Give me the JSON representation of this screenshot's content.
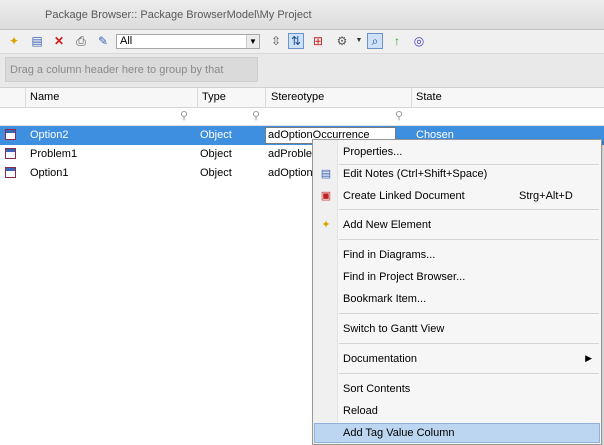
{
  "window": {
    "title": "Package Browser:: Package BrowserModel\\My Project"
  },
  "toolbar": {
    "filter_value": "All",
    "buttons": [
      {
        "name": "new-element-icon",
        "glyph": "✦"
      },
      {
        "name": "notes-icon",
        "glyph": "▤"
      },
      {
        "name": "delete-icon",
        "glyph": "✕"
      },
      {
        "name": "print-icon",
        "glyph": "⎙"
      },
      {
        "name": "edit-icon",
        "glyph": "✎"
      }
    ]
  },
  "group_panel": {
    "hint": "Drag a column header here to group by that column."
  },
  "grid": {
    "columns": [
      "Name",
      "Type",
      "Stereotype",
      "State"
    ],
    "rows": [
      {
        "name": "Option2",
        "type": "Object",
        "stereotype": "adOptionOccurrence",
        "state": "Chosen",
        "selected": true
      },
      {
        "name": "Problem1",
        "type": "Object",
        "stereotype": "adProble",
        "state": "",
        "selected": false
      },
      {
        "name": "Option1",
        "type": "Object",
        "stereotype": "adOption",
        "state": "",
        "selected": false
      }
    ]
  },
  "context_menu": {
    "items": [
      {
        "label": "Properties...",
        "shortcut": "",
        "icon": ""
      },
      {
        "label": "Edit Notes (Ctrl+Shift+Space)",
        "shortcut": "",
        "icon": "notes-icon"
      },
      {
        "label": "Create Linked Document",
        "shortcut": "Strg+Alt+D",
        "icon": "linked-document-icon"
      },
      {
        "label": "Add New Element",
        "shortcut": "",
        "icon": "new-element-icon"
      },
      {
        "label": "Find in Diagrams...",
        "shortcut": "",
        "icon": ""
      },
      {
        "label": "Find in Project Browser...",
        "shortcut": "",
        "icon": ""
      },
      {
        "label": "Bookmark Item...",
        "shortcut": "",
        "icon": ""
      },
      {
        "label": "Switch to Gantt View",
        "shortcut": "",
        "icon": ""
      },
      {
        "label": "Documentation",
        "shortcut": "",
        "icon": "",
        "submenu": true
      },
      {
        "label": "Sort Contents",
        "shortcut": "",
        "icon": ""
      },
      {
        "label": "Reload",
        "shortcut": "",
        "icon": ""
      },
      {
        "label": "Add Tag Value Column",
        "shortcut": "",
        "icon": "",
        "highlighted": true
      }
    ]
  },
  "colors": {
    "selection": "#3f8fe0",
    "menu_highlight": "#bcd6f2"
  }
}
